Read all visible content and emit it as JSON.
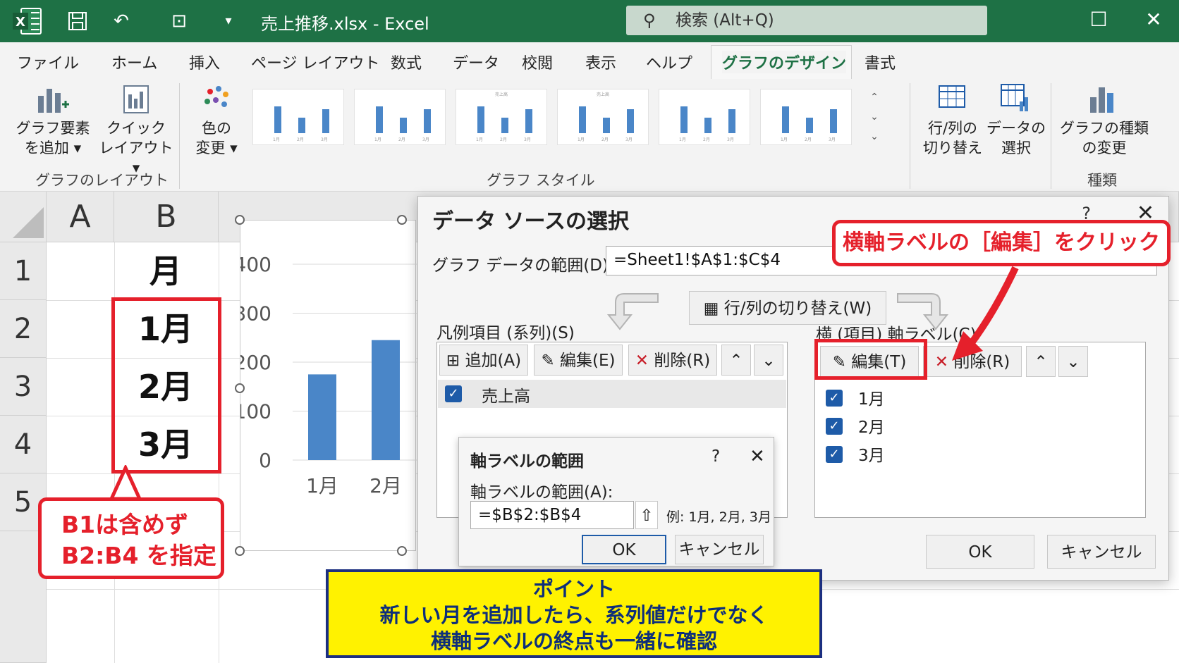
{
  "titlebar": {
    "filename": "売上推移.xlsx",
    "app": "Excel",
    "search_placeholder": "検索 (Alt+Q)",
    "bg_color": "#1e7145"
  },
  "ribbon": {
    "tabs": [
      "ファイル",
      "ホーム",
      "挿入",
      "ページ レイアウト",
      "数式",
      "データ",
      "校閲",
      "表示",
      "ヘルプ",
      "グラフのデザイン",
      "書式"
    ],
    "active_tab": "グラフのデザイン",
    "add_element": [
      "グラフ要素",
      "を追加 ▾"
    ],
    "quick_layout": [
      "クイック",
      "レイアウト ▾"
    ],
    "change_color": [
      "色の",
      "変更 ▾"
    ],
    "group_layout": "グラフのレイアウト",
    "group_style": "グラフ スタイル",
    "switch_row_col": [
      "行/列の",
      "切り替え"
    ],
    "select_data": [
      "データの",
      "選択"
    ],
    "change_type": [
      "グラフの種類",
      "の変更"
    ],
    "group_type": "種類",
    "thumb_labels": [
      "1月",
      "2月",
      "3月"
    ],
    "thumb_title": "売上高"
  },
  "sheet": {
    "columns": [
      "A",
      "B"
    ],
    "rows": [
      "1",
      "2",
      "3",
      "4",
      "5"
    ],
    "b_cells": [
      "月",
      "1月",
      "2月",
      "3月"
    ]
  },
  "chart": {
    "y_ticks": [
      "400",
      "300",
      "200",
      "100",
      "0"
    ],
    "x_labels": [
      "1月",
      "2月"
    ]
  },
  "chart_data": {
    "type": "bar",
    "categories": [
      "1月",
      "2月"
    ],
    "values": [
      175,
      245
    ],
    "ylim": [
      0,
      400
    ],
    "color": "#4a86c8"
  },
  "dialog": {
    "title": "データ ソースの選択",
    "help": "?",
    "range_label": "グラフ データの範囲(D):",
    "range_value": "=Sheet1!$A$1:$C$4",
    "switch_btn": "行/列の切り替え(W)",
    "legend_label": "凡例項目 (系列)(S)",
    "add_btn": "追加(A)",
    "edit_btn": "編集(E)",
    "delete_btn": "削除(R)",
    "series": [
      "売上高"
    ],
    "axis_label": "横 (項目) 軸ラベル(C)",
    "axis_edit_btn": "編集(T)",
    "axis_delete_btn": "削除(R)",
    "axis_items": [
      "1月",
      "2月",
      "3月"
    ],
    "ok": "OK",
    "cancel": "キャンセル"
  },
  "subdialog": {
    "title": "軸ラベルの範囲",
    "help": "?",
    "label": "軸ラベルの範囲(A):",
    "value": "=$B$2:$B$4",
    "example": "例: 1月, 2月, 3月",
    "ok": "OK",
    "cancel": "キャンセル"
  },
  "annotations": {
    "top_callout": "横軸ラベルの［編集］をクリック",
    "left_callout": [
      "B1は含めず",
      "B2:B4 を指定"
    ],
    "point": [
      "ポイント",
      "新しい月を追加したら、系列値だけでなく",
      "横軸ラベルの終点も一緒に確認"
    ],
    "red": "#e5202b",
    "yellow": "#fff200",
    "navy": "#1c2f80"
  }
}
